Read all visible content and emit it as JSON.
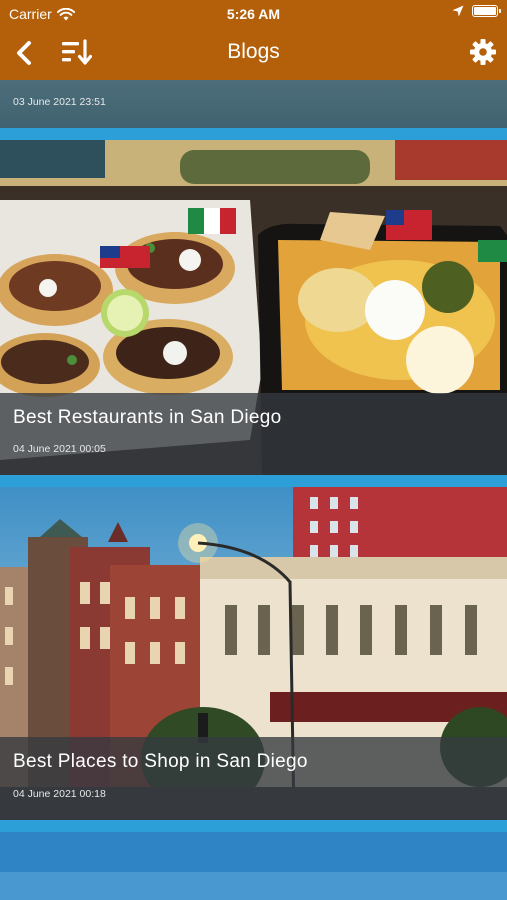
{
  "status_bar": {
    "carrier": "Carrier",
    "time": "5:26 AM",
    "icons": [
      "wifi-icon",
      "location-arrow-icon",
      "battery-icon"
    ]
  },
  "nav": {
    "title": "Blogs",
    "icons": [
      "back-chevron-icon",
      "sort-descending-icon",
      "gear-icon"
    ]
  },
  "colors": {
    "header": "#b4600a",
    "separator": "#2c9fd8",
    "overlay": "#343a40"
  },
  "posts": [
    {
      "title": "",
      "date": "03 June 2021 23:51"
    },
    {
      "title": "Best Restaurants in San Diego",
      "date": "04 June 2021 00:05"
    },
    {
      "title": "Best Places to Shop in San Diego",
      "date": "04 June 2021 00:18"
    }
  ]
}
